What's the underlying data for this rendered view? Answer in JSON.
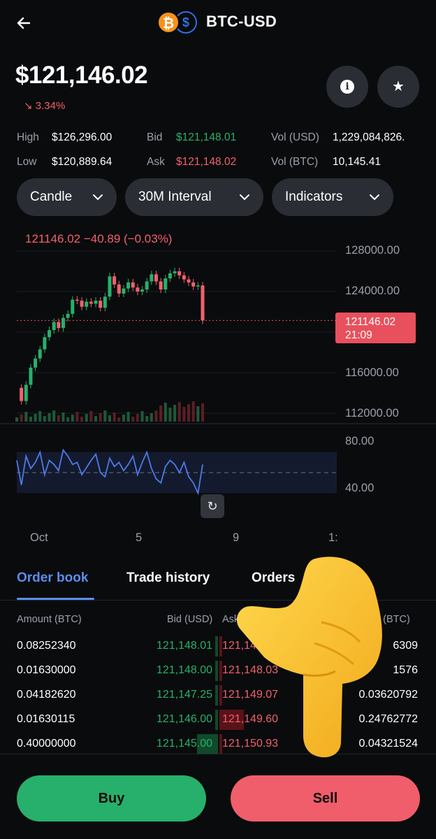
{
  "header": {
    "back_icon": "arrow-left-icon",
    "pair": "BTC-USD",
    "base_symbol": "₿",
    "quote_symbol": "$"
  },
  "price": {
    "current": "$121,146.02",
    "change": "3.34%",
    "change_direction": "down"
  },
  "stats": {
    "high_label": "High",
    "high_value": "$126,296.00",
    "low_label": "Low",
    "low_value": "$120,889.64",
    "bid_label": "Bid",
    "bid_value": "$121,148.01",
    "ask_label": "Ask",
    "ask_value": "$121,148.02",
    "vol_usd_label": "Vol (USD)",
    "vol_usd_value": "1,229,084,826.",
    "vol_btc_label": "Vol (BTC)",
    "vol_btc_value": "10,145.41"
  },
  "controls": {
    "chart_type": "Candle",
    "interval": "30M Interval",
    "indicators": "Indicators"
  },
  "chart": {
    "header": "121146.02  −40.89 (−0.03%)",
    "y_labels": [
      "128000.00",
      "124000.00",
      "116000.00",
      "112000.00"
    ],
    "price_tag_value": "121146.02",
    "price_tag_time": "21:09",
    "rsi_labels": [
      "80.00",
      "40.00"
    ],
    "x_labels": [
      "Oct",
      "5",
      "9",
      "1:"
    ]
  },
  "chart_data": {
    "type": "line",
    "x": [
      0,
      1,
      2,
      3,
      4,
      5,
      6,
      7,
      8,
      9,
      10,
      11,
      12,
      13,
      14,
      15,
      16,
      17,
      18,
      19,
      20,
      21,
      22,
      23,
      24,
      25,
      26,
      27,
      28,
      29,
      30,
      31,
      32,
      33,
      34,
      35,
      36,
      37,
      38,
      39,
      40
    ],
    "series": [
      {
        "values": [
          114500,
          113200,
          114800,
          116500,
          117400,
          118300,
          119500,
          120200,
          121000,
          120400,
          121400,
          121800,
          123200,
          123100,
          122500,
          123000,
          122800,
          123100,
          122400,
          123500,
          125500,
          124700,
          123800,
          124300,
          124900,
          124400,
          124000,
          124200,
          125000,
          125700,
          125000,
          124200,
          125300,
          125800,
          126000,
          125600,
          125200,
          124900,
          124500,
          124600,
          121146
        ]
      }
    ],
    "ylim": [
      112000,
      128000
    ],
    "rsi": [
      62,
      38,
      66,
      54,
      60,
      70,
      48,
      62,
      58,
      52,
      72,
      66,
      58,
      60,
      48,
      55,
      62,
      68,
      50,
      46,
      64,
      56,
      60,
      52,
      58,
      66,
      48,
      60,
      70,
      54,
      44,
      40,
      56,
      62,
      58,
      50,
      60,
      46,
      40,
      30,
      58
    ]
  },
  "tabs": [
    "Order book",
    "Trade history",
    "Orders"
  ],
  "orderbook": {
    "headers": {
      "amount": "Amount (BTC)",
      "bid": "Bid (USD)",
      "ask": "Ask",
      "amount_right": "nt (BTC)"
    },
    "rows": [
      {
        "amount": "0.08252340",
        "bid": "121,148.01",
        "ask": "121,148.02",
        "ask_amount": "6309",
        "bid_depth": 0.02,
        "ask_depth": 0.03
      },
      {
        "amount": "0.01630000",
        "bid": "121,148.00",
        "ask": "121,148.03",
        "ask_amount": "1576",
        "bid_depth": 0.01,
        "ask_depth": 0.02
      },
      {
        "amount": "0.04182620",
        "bid": "121,147.25",
        "ask": "121,149.07",
        "ask_amount": "0.03620792",
        "bid_depth": 0.02,
        "ask_depth": 0.03
      },
      {
        "amount": "0.01630115",
        "bid": "121,146.00",
        "ask": "121,149.60",
        "ask_amount": "0.24762772",
        "bid_depth": 0.01,
        "ask_depth": 0.35
      },
      {
        "amount": "0.40000000",
        "bid": "121,145.00",
        "ask": "121,150.93",
        "ask_amount": "0.04321524",
        "bid_depth": 0.3,
        "ask_depth": 0.04
      }
    ]
  },
  "actions": {
    "buy": "Buy",
    "sell": "Sell"
  },
  "colors": {
    "green": "#27b06b",
    "red": "#f0616d",
    "accent": "#5b8def",
    "btc": "#f7931a"
  }
}
